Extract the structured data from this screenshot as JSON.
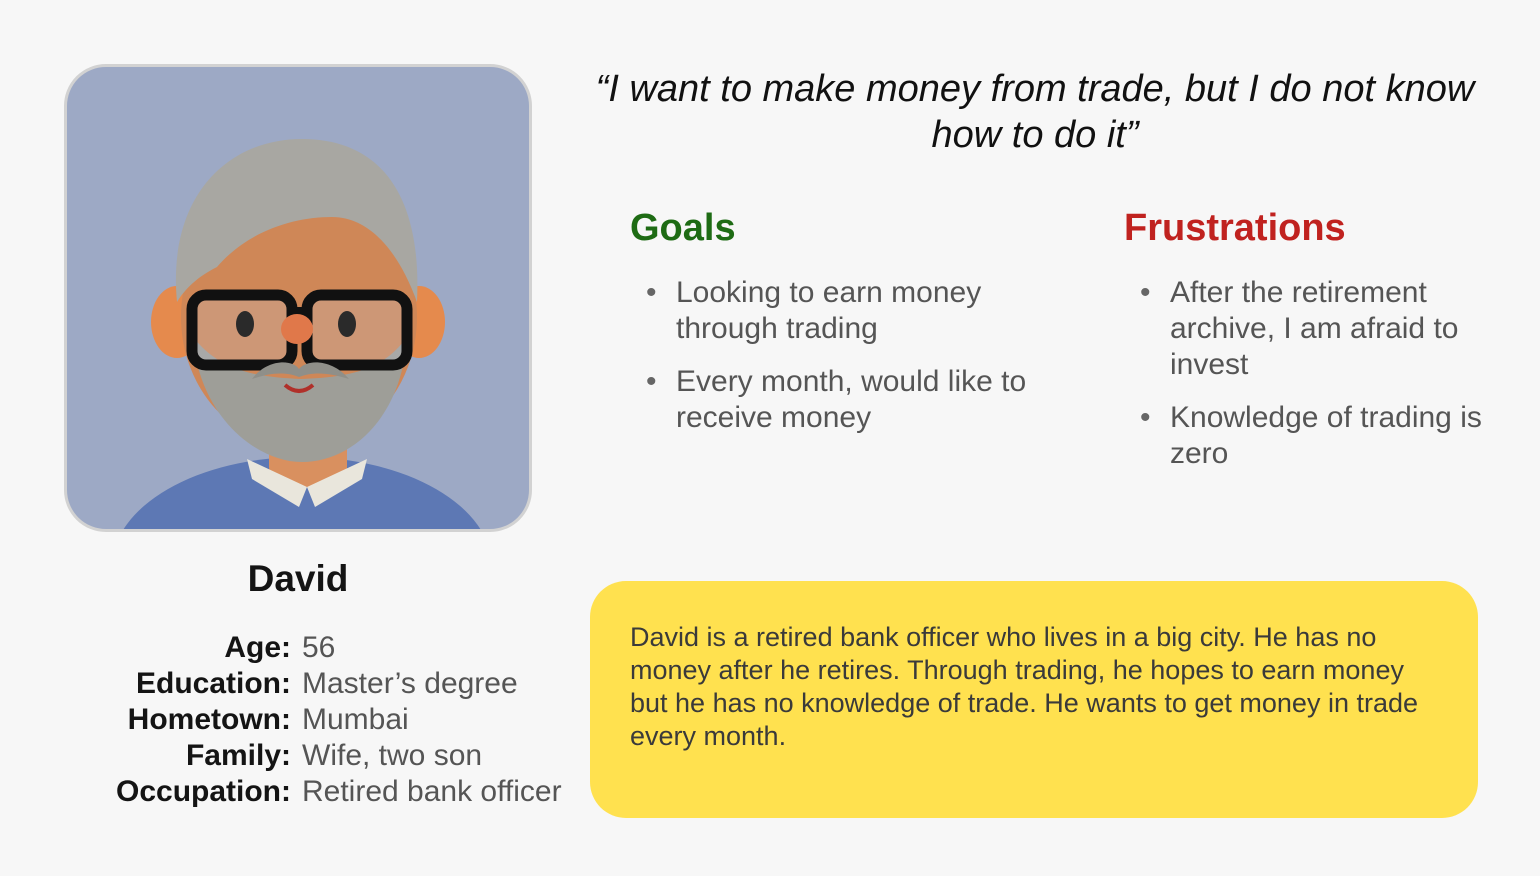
{
  "persona": {
    "name": "David",
    "details": [
      {
        "label": "Age:",
        "value": "56"
      },
      {
        "label": "Education:",
        "value": "Master’s degree"
      },
      {
        "label": "Hometown:",
        "value": "Mumbai"
      },
      {
        "label": "Family:",
        "value": "Wife, two son"
      },
      {
        "label": "Occupation:",
        "value": "Retired bank officer"
      }
    ]
  },
  "quote": "“I want to make money from trade, but I do not know how to do it”",
  "goals": {
    "title": "Goals",
    "items": [
      "Looking to earn money through trading",
      "Every month, would like to receive money"
    ]
  },
  "frustrations": {
    "title": "Frustrations",
    "items": [
      "After the retirement archive, I am afraid to invest",
      "Knowledge of trading is zero"
    ]
  },
  "bio": "David is a retired bank officer who lives in a big city. He has no money after he retires. Through trading, he hopes to earn money but he has no knowledge of trade. He wants to get money in trade every month.",
  "colors": {
    "goals_title": "#1e6b14",
    "frustrations_title": "#c0221f",
    "bio_background": "#ffe14f",
    "avatar_background": "#9da9c5"
  }
}
